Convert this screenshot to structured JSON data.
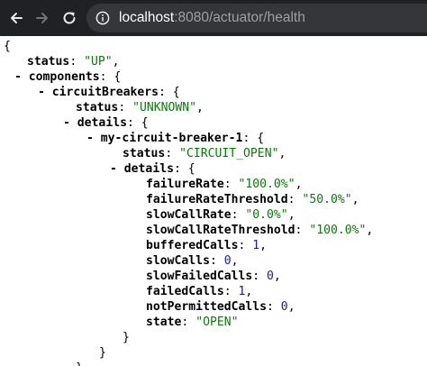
{
  "browser": {
    "url_host": "localhost",
    "url_rest": ":8080/actuator/health"
  },
  "json": {
    "open_brace": "{",
    "status_key": "status",
    "status_value": "\"UP\"",
    "components_key": "components",
    "circuitBreakers_key": "circuitBreakers",
    "cb_status_key": "status",
    "cb_status_value": "\"UNKNOWN\"",
    "cb_details_key": "details",
    "breaker_key": "my-circuit-breaker-1",
    "breaker_status_key": "status",
    "breaker_status_value": "\"CIRCUIT_OPEN\"",
    "breaker_details_key": "details",
    "fields": [
      {
        "key": "failureRate",
        "value": "\"100.0%\"",
        "type": "str"
      },
      {
        "key": "failureRateThreshold",
        "value": "\"50.0%\"",
        "type": "str"
      },
      {
        "key": "slowCallRate",
        "value": "\"0.0%\"",
        "type": "str"
      },
      {
        "key": "slowCallRateThreshold",
        "value": "\"100.0%\"",
        "type": "str"
      },
      {
        "key": "bufferedCalls",
        "value": "1",
        "type": "num"
      },
      {
        "key": "slowCalls",
        "value": "0",
        "type": "num"
      },
      {
        "key": "slowFailedCalls",
        "value": "0",
        "type": "num"
      },
      {
        "key": "failedCalls",
        "value": "1",
        "type": "num"
      },
      {
        "key": "notPermittedCalls",
        "value": "0",
        "type": "num"
      },
      {
        "key": "state",
        "value": "\"OPEN\"",
        "type": "str"
      }
    ],
    "close_brace": "}",
    "collapse_marker": "-"
  },
  "colors": {
    "toolbar_bg": "#202124",
    "omnibox_bg": "#35363a",
    "string": "#0b7a0b",
    "number": "#1a1aa6"
  }
}
